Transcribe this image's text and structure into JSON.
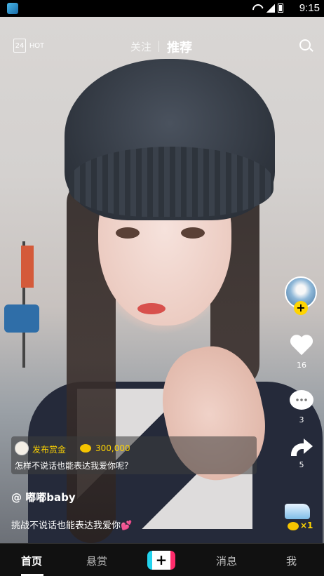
{
  "status_bar": {
    "time": "9:15"
  },
  "top_nav": {
    "calendar_day": "24",
    "hot_label": "HOT",
    "tabs": [
      {
        "label": "关注",
        "active": false
      },
      {
        "label": "推荐",
        "active": true
      }
    ]
  },
  "actions": {
    "likes": "16",
    "comments": "3",
    "shares": "5"
  },
  "bounty": {
    "tag": "发布赏金",
    "amount": "300,000",
    "question": "怎样不说话也能表达我爱你呢？"
  },
  "video": {
    "username": "@ 嘟嘟baby",
    "caption": "挑战不说话也能表达我爱你",
    "caption_emoji": "💕"
  },
  "sticker": {
    "multiplier": "×1"
  },
  "bottom_nav": {
    "items": [
      "首页",
      "悬赏",
      "+",
      "消息",
      "我"
    ],
    "active_index": 0
  },
  "colors": {
    "accent_yellow": "#ffd400",
    "post_left": "#22d3ee",
    "post_right": "#ff2b6b"
  }
}
